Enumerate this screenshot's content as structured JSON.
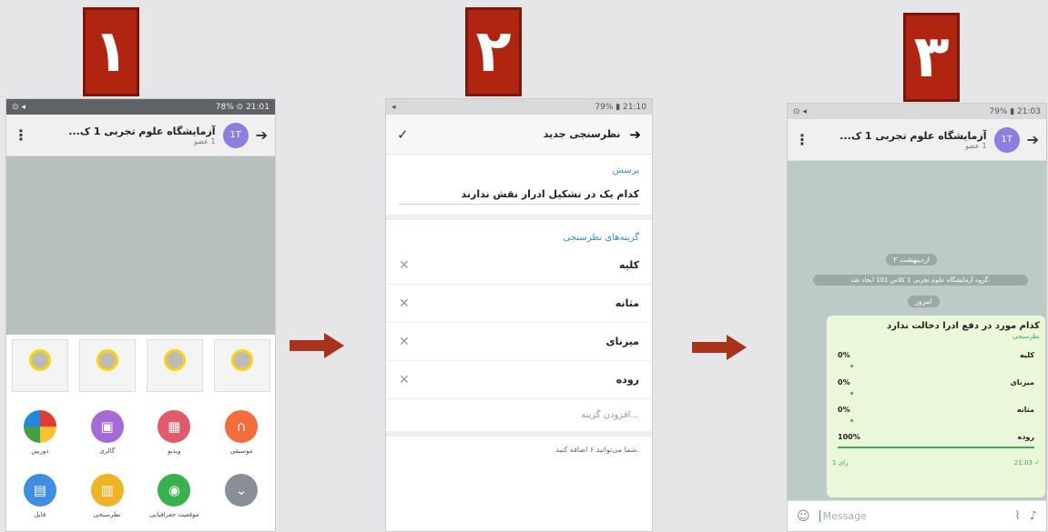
{
  "badges": [
    "۱",
    "۲",
    "۳"
  ],
  "colors": {
    "badge": "#b1240f",
    "arrow": "#a8321a",
    "accent": "#2f8fd8",
    "bubble": "#eaf7d8",
    "bar": "#37b24d"
  },
  "phone1": {
    "status_left": "⊙ ◂",
    "status_right": "78% ⊙ 21:01",
    "title": "آزمایشگاه علوم تجربی 1 ک...",
    "subtitle": "1 عضو",
    "avatar": "1T",
    "attachments": [
      {
        "label": "دوربین",
        "color": "#ff9800",
        "icon": "camera-icon"
      },
      {
        "label": "گالری",
        "color": "#a56ad8",
        "icon": "gallery-icon"
      },
      {
        "label": "ویدیو",
        "color": "#e15a6b",
        "icon": "video-icon"
      },
      {
        "label": "موسیقی",
        "color": "#f36d3c",
        "icon": "headphones-icon"
      },
      {
        "label": "فایل",
        "color": "#3f8fe0",
        "icon": "file-icon"
      },
      {
        "label": "نظرسنجی",
        "color": "#f0b323",
        "icon": "poll-icon"
      },
      {
        "label": "موقعیت جغرافیایی",
        "color": "#37b24d",
        "icon": "location-icon"
      },
      {
        "label": "",
        "color": "#8a8f97",
        "icon": "chevron-down-icon"
      }
    ]
  },
  "phone2": {
    "status_left": "◂",
    "status_right": "79% ▮ 21:10",
    "header_title": "نظرسنجی جدید",
    "question_label": "پرسش",
    "question": "کدام یک در تشکیل ادرار نقش ندارند",
    "options_label": "گزینه‌های نظرسنجی",
    "options": [
      "کلیه",
      "مثانه",
      "میزنای",
      "روده"
    ],
    "add_option": "افزودن گزینه...",
    "hint": "شما می‌توانید ۶ اضافه کنید."
  },
  "phone3": {
    "status_left": "⊙ ◂",
    "status_right": "79% ▮ 21:03",
    "title": "آزمایشگاه علوم تجربی 1 ک...",
    "subtitle": "1 عضو",
    "avatar": "1T",
    "date_chip": "۲ اردیبهشت",
    "system_msg": "گروه آزمایشگاه علوم تجربی 1 کلاس 101 ایجاد شد.",
    "today_chip": "امروز",
    "poll_question": "کدام مورد در دفع ادرا دخالت ندارد",
    "poll_type": "نظرسنجی",
    "results": [
      {
        "option": "کلیه",
        "percent": "0%",
        "fraction": 0
      },
      {
        "option": "میزنای",
        "percent": "0%",
        "fraction": 0
      },
      {
        "option": "مثانه",
        "percent": "0%",
        "fraction": 0
      },
      {
        "option": "روده",
        "percent": "100%",
        "fraction": 1
      }
    ],
    "votes": "1 رای",
    "time": "21:03 ✓",
    "input_placeholder": "Message"
  }
}
